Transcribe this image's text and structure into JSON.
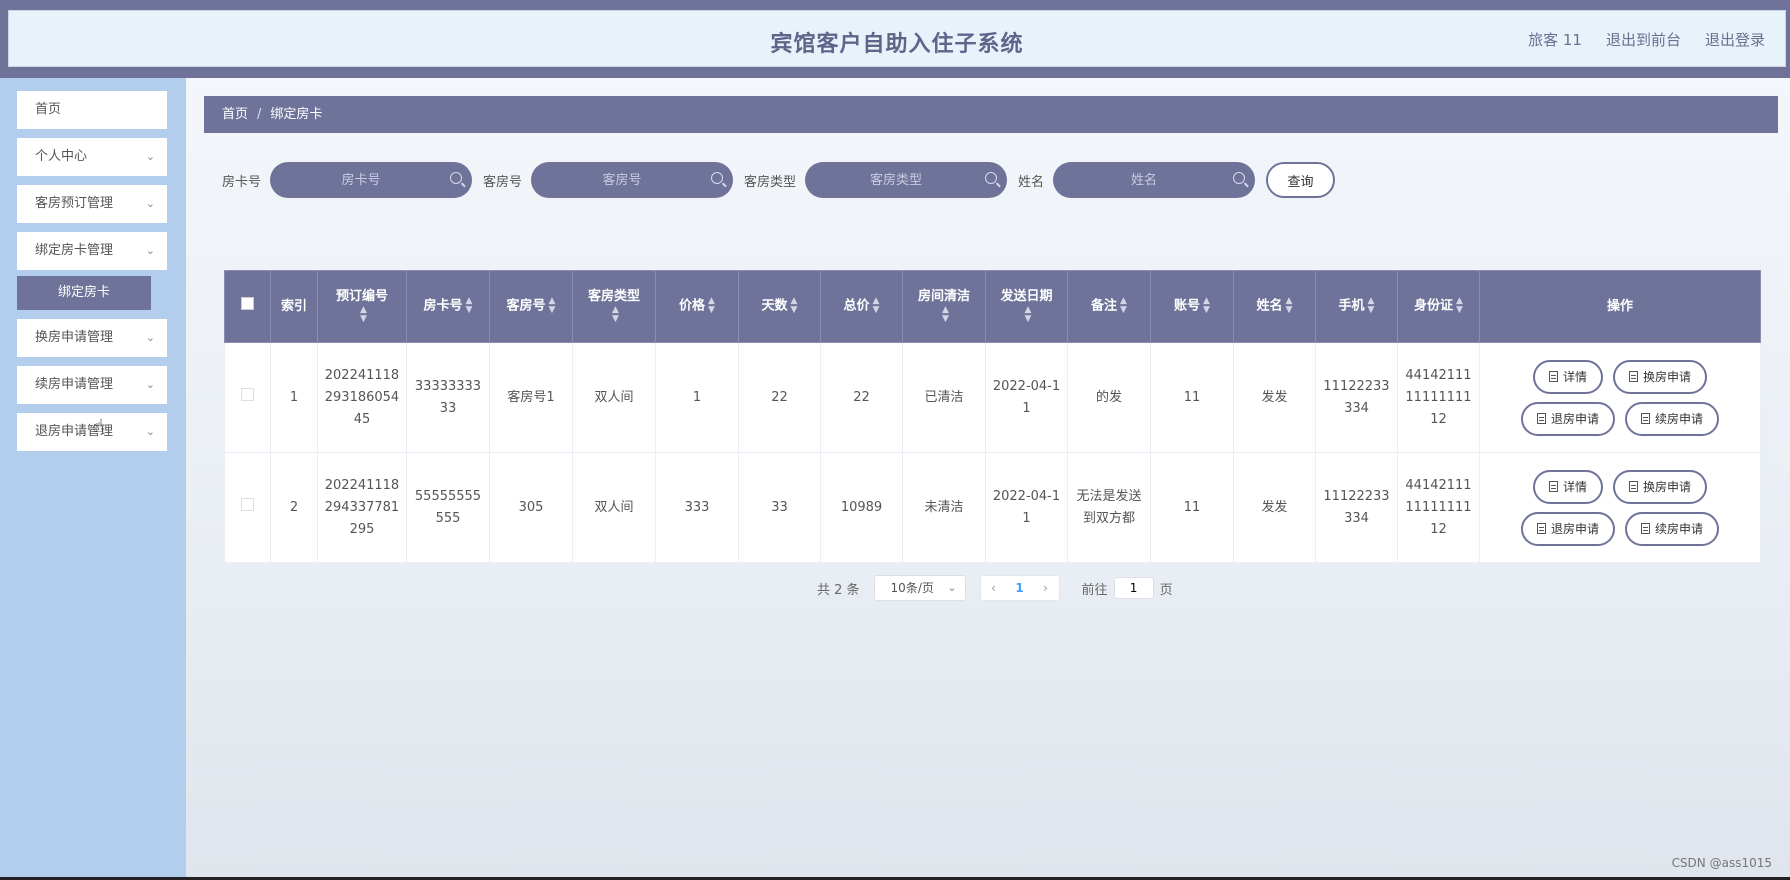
{
  "header": {
    "title": "宾馆客户自助入住子系统",
    "links": [
      "旅客 11",
      "退出到前台",
      "退出登录"
    ]
  },
  "sidebar": {
    "items": [
      {
        "label": "首页"
      },
      {
        "label": "个人中心"
      },
      {
        "label": "客房预订管理"
      },
      {
        "label": "绑定房卡管理"
      },
      {
        "label": "换房申请管理"
      },
      {
        "label": "续房申请管理"
      },
      {
        "label": "退房申请管理"
      }
    ],
    "submenu_active": "绑定房卡"
  },
  "breadcrumb": {
    "home": "首页",
    "sep": "/",
    "current": "绑定房卡"
  },
  "search": {
    "fields": [
      {
        "label": "房卡号",
        "placeholder": "房卡号"
      },
      {
        "label": "客房号",
        "placeholder": "客房号"
      },
      {
        "label": "客房类型",
        "placeholder": "客房类型"
      },
      {
        "label": "姓名",
        "placeholder": "姓名"
      }
    ],
    "button": "查询"
  },
  "table": {
    "headers": [
      "索引",
      "预订编号",
      "房卡号",
      "客房号",
      "客房类型",
      "价格",
      "天数",
      "总价",
      "房间清洁",
      "发送日期",
      "备注",
      "账号",
      "姓名",
      "手机",
      "身份证",
      "操作"
    ],
    "rows": [
      [
        "1",
        "202241118293186054 45",
        "3333333333",
        "客房号1",
        "双人间",
        "1",
        "22",
        "22",
        "已清洁",
        "2022-04-11",
        "的发",
        "11",
        "发发",
        "11122233334",
        "441421111111111112"
      ],
      [
        "2",
        "202241118294337781 295",
        "55555555555",
        "305",
        "双人间",
        "333",
        "33",
        "10989",
        "未清洁",
        "2022-04-11",
        "无法是发送到双方都",
        "11",
        "发发",
        "11122233334",
        "441421111111111112"
      ]
    ],
    "actions": [
      "详情",
      "换房申请",
      "退房申请",
      "续房申请"
    ]
  },
  "pagination": {
    "total": "共 2 条",
    "page_size": "10条/页",
    "current_page": "1",
    "goto_label": "前往",
    "goto_value": "1",
    "page_suffix": "页"
  },
  "watermark": "CSDN @ass1015"
}
